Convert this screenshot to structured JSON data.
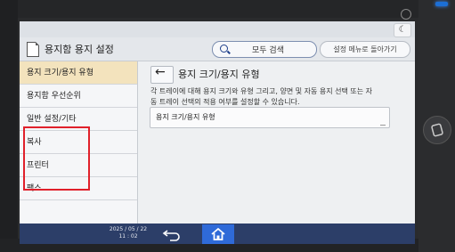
{
  "header": {
    "title": "용지함 용지 설정",
    "search_label": "모두 검색",
    "home_menu_label": "설정 메뉴로 돌아가기"
  },
  "menu": {
    "items": [
      {
        "label": "용지 크기/용지 유형",
        "selected": true
      },
      {
        "label": "용지함 우선순위",
        "selected": false
      },
      {
        "label": "일반 설정/기타",
        "selected": false
      },
      {
        "label": "복사",
        "selected": false
      },
      {
        "label": "프린터",
        "selected": false
      },
      {
        "label": "팩스",
        "selected": false
      }
    ]
  },
  "main": {
    "section_title": "용지 크기/용지 유형",
    "description_line1": "각 트레이에 대해 용지 크기와 유형 그리고, 양면 및 자동 용지 선택 또는 자",
    "description_line2": "동 트레이 선택의 적용 여부를 설정할 수 있습니다.",
    "sub_item_label": "용지 크기/용지 유형"
  },
  "statusbar": {
    "date": "2025 / 05 / 22",
    "time": "11 : 02"
  },
  "colors": {
    "selected_bg": "#f3e3bd",
    "highlight_border": "#e0202a",
    "bottom_bar": "#2c3e68",
    "home_active": "#2f6ad8"
  }
}
